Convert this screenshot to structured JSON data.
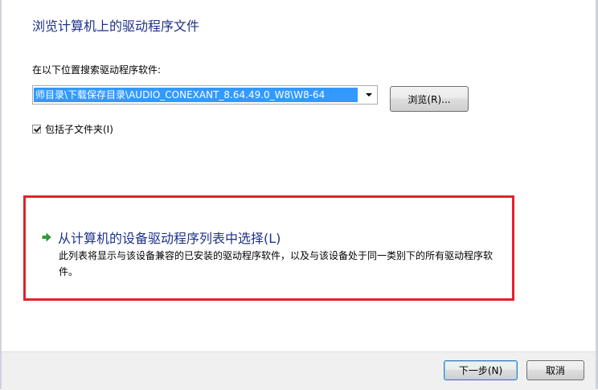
{
  "dialog": {
    "heading": "浏览计算机上的驱动程序文件"
  },
  "search": {
    "label": "在以下位置搜索驱动程序软件:",
    "path_value": "师目录\\下载保存目录\\AUDIO_CONEXANT_8.64.49.0_W8\\W8-64",
    "browse_label": "浏览(R)..."
  },
  "subfolders": {
    "label": "包括子文件夹(I)",
    "checked": true
  },
  "pick_option": {
    "title": "从计算机的设备驱动程序列表中选择(L)",
    "description": "此列表将显示与该设备兼容的已安装的驱动程序软件，以及与该设备处于同一类别下的所有驱动程序软件。",
    "highlight_color": "#e3212b",
    "icon": "green-arrow-icon"
  },
  "footer": {
    "next_label": "下一步(N)",
    "cancel_label": "取消"
  }
}
